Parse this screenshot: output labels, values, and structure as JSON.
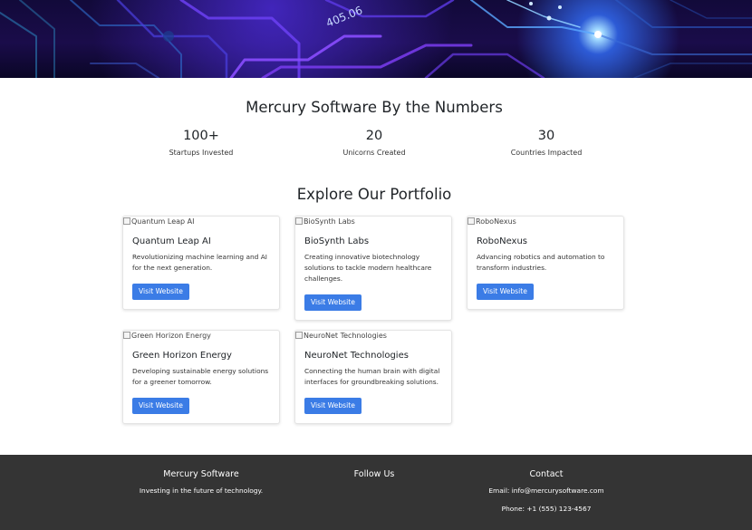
{
  "hero": {
    "chip_label": "405.06"
  },
  "stats": {
    "title": "Mercury Software By the Numbers",
    "items": [
      {
        "value": "100+",
        "label": "Startups Invested"
      },
      {
        "value": "20",
        "label": "Unicorns Created"
      },
      {
        "value": "30",
        "label": "Countries Impacted"
      }
    ]
  },
  "portfolio": {
    "title": "Explore Our Portfolio",
    "cards": [
      {
        "image_alt": "Quantum Leap AI",
        "name": "Quantum Leap AI",
        "description": "Revolutionizing machine learning and AI for the next generation.",
        "button": "Visit Website"
      },
      {
        "image_alt": "BioSynth Labs",
        "name": "BioSynth Labs",
        "description": "Creating innovative biotechnology solutions to tackle modern healthcare challenges.",
        "button": "Visit Website"
      },
      {
        "image_alt": "RoboNexus",
        "name": "RoboNexus",
        "description": "Advancing robotics and automation to transform industries.",
        "button": "Visit Website"
      },
      {
        "image_alt": "Green Horizon Energy",
        "name": "Green Horizon Energy",
        "description": "Developing sustainable energy solutions for a greener tomorrow.",
        "button": "Visit Website"
      },
      {
        "image_alt": "NeuroNet Technologies",
        "name": "NeuroNet Technologies",
        "description": "Connecting the human brain with digital interfaces for groundbreaking solutions.",
        "button": "Visit Website"
      }
    ]
  },
  "footer": {
    "about": {
      "heading": "Mercury Software",
      "text": "Investing in the future of technology."
    },
    "follow": {
      "heading": "Follow Us"
    },
    "contact": {
      "heading": "Contact",
      "email": "Email: info@mercurysoftware.com",
      "phone": "Phone: +1 (555) 123-4567"
    }
  },
  "colors": {
    "button": "#3b7ce6",
    "footer_bg": "#343434",
    "hero_glow": "#7b3cff"
  }
}
